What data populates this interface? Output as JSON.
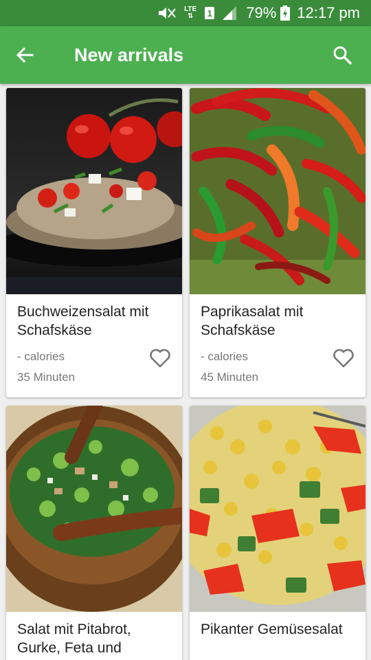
{
  "status_bar": {
    "network": "LTE",
    "sim_slot": "1",
    "battery": "79%",
    "time": "12:17 pm",
    "icons": [
      "mute-icon",
      "lte-icon",
      "sim-icon",
      "signal-icon",
      "battery-charging-icon"
    ]
  },
  "app_bar": {
    "title": "New arrivals",
    "back_icon": "arrow-back-icon",
    "search_icon": "search-icon",
    "color": "#4caf50"
  },
  "recipes": [
    {
      "name": "Buchweizensalat mit Schafskäse",
      "calories": "- calories",
      "duration": "35 Minuten",
      "favorite_icon": "heart-outline-icon"
    },
    {
      "name": "Paprikasalat mit Schafskäse",
      "calories": "- calories",
      "duration": "45 Minuten",
      "favorite_icon": "heart-outline-icon"
    },
    {
      "name": "Salat mit Pitabrot, Gurke, Feta und",
      "calories": "",
      "duration": "",
      "favorite_icon": ""
    },
    {
      "name": "Pikanter Gemüsesalat",
      "calories": "",
      "duration": "",
      "favorite_icon": ""
    }
  ]
}
